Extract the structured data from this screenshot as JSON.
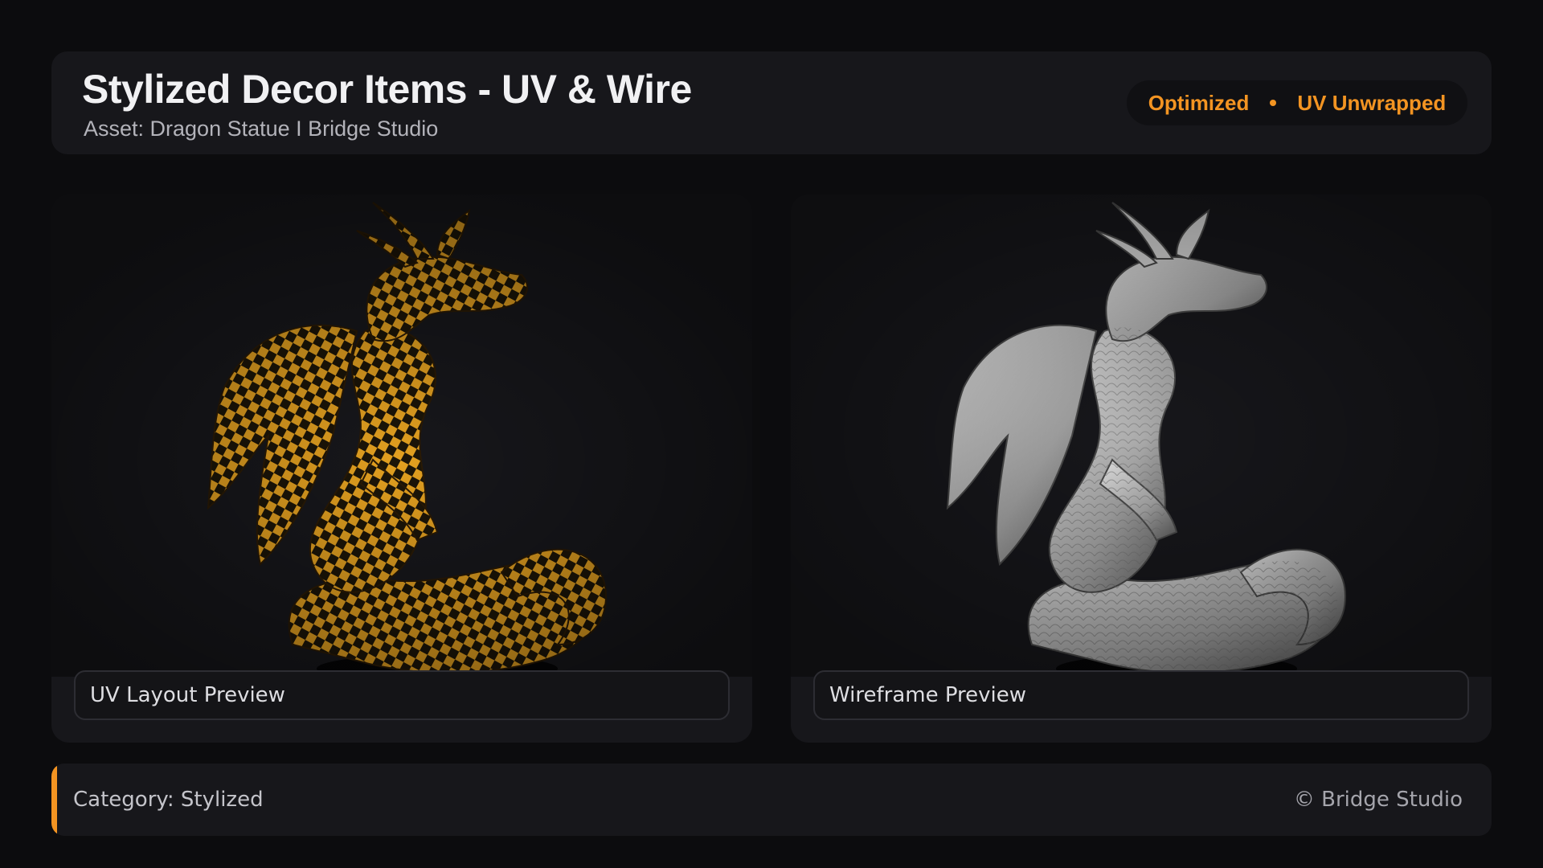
{
  "header": {
    "title": "Stylized Decor Items - UV & Wire",
    "subtitle": "Asset: Dragon Statue  I  Bridge Studio",
    "badges": [
      "Optimized",
      "UV Unwrapped"
    ]
  },
  "previews": [
    {
      "caption": "UV Layout Preview",
      "image": "dragon-statue-checker-uv-render"
    },
    {
      "caption": "Wireframe Preview",
      "image": "dragon-statue-white-clay-render"
    }
  ],
  "footer": {
    "category": "Category: Stylized",
    "copyright": "© Bridge Studio"
  },
  "colors": {
    "accent": "#f39422",
    "background": "#0c0c0e",
    "panel": "#17171b"
  }
}
